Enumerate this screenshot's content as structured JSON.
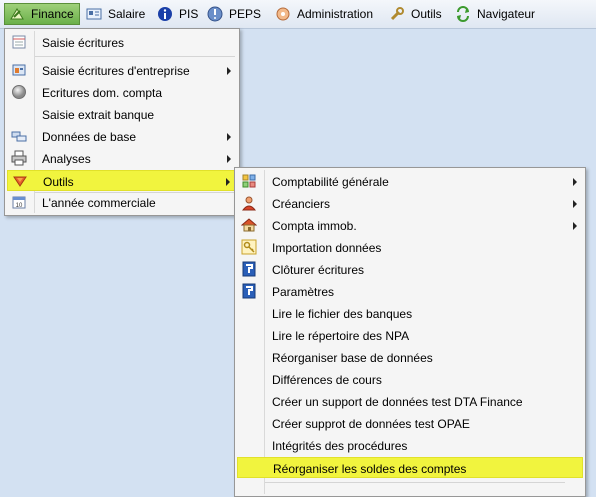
{
  "menubar": {
    "items": [
      {
        "label": "Finance",
        "icon": "finance-icon"
      },
      {
        "label": "Salaire",
        "icon": "salary-card-icon"
      },
      {
        "label": "PIS",
        "icon": "info-icon"
      },
      {
        "label": "PEPS",
        "icon": "peps-icon"
      },
      {
        "label": "Administration",
        "icon": "administration-icon"
      },
      {
        "label": "Outils",
        "icon": "wrench-icon"
      },
      {
        "label": "Navigateur",
        "icon": "navigator-icon"
      }
    ]
  },
  "finance_menu": {
    "items": [
      {
        "label": "Saisie écritures",
        "icon": "journal-icon"
      },
      {
        "label": "Saisie écritures d'entreprise",
        "icon": "company-entries-icon",
        "submenu": true
      },
      {
        "label": "Ecritures dom. compta",
        "icon": "disc-icon"
      },
      {
        "label": "Saisie extrait banque"
      },
      {
        "label": "Données de base",
        "icon": "base-data-icon",
        "submenu": true
      },
      {
        "label": "Analyses",
        "icon": "printer-icon",
        "submenu": true
      },
      {
        "label": "Outils",
        "icon": "tools-icon",
        "submenu": true,
        "highlighted": true
      },
      {
        "label": "L'année commerciale",
        "icon": "calendar-icon"
      }
    ]
  },
  "outils_submenu": {
    "items": [
      {
        "label": "Comptabilité générale",
        "icon": "ledger-icon",
        "submenu": true
      },
      {
        "label": "Créanciers",
        "icon": "creditor-icon",
        "submenu": true
      },
      {
        "label": "Compta immob.",
        "icon": "house-icon",
        "submenu": true
      },
      {
        "label": "Importation données",
        "icon": "key-icon"
      },
      {
        "label": "Clôturer écritures",
        "icon": "close-entries-icon"
      },
      {
        "label": "Paramètres",
        "icon": "parameters-icon"
      },
      {
        "label": "Lire le fichier des banques"
      },
      {
        "label": "Lire le répertoire des NPA"
      },
      {
        "label": "Réorganiser base de données"
      },
      {
        "label": "Différences de cours"
      },
      {
        "label": "Créer un support de données test DTA Finance"
      },
      {
        "label": "Créer supprot de données test OPAE"
      },
      {
        "label": "Intégrités des procédures"
      },
      {
        "label": "Réorganiser les soldes des comptes",
        "highlighted": true
      }
    ]
  },
  "colors": {
    "highlight": "#f1f43e",
    "active_menu": "#7cbf55",
    "background": "#d3e1f2"
  }
}
